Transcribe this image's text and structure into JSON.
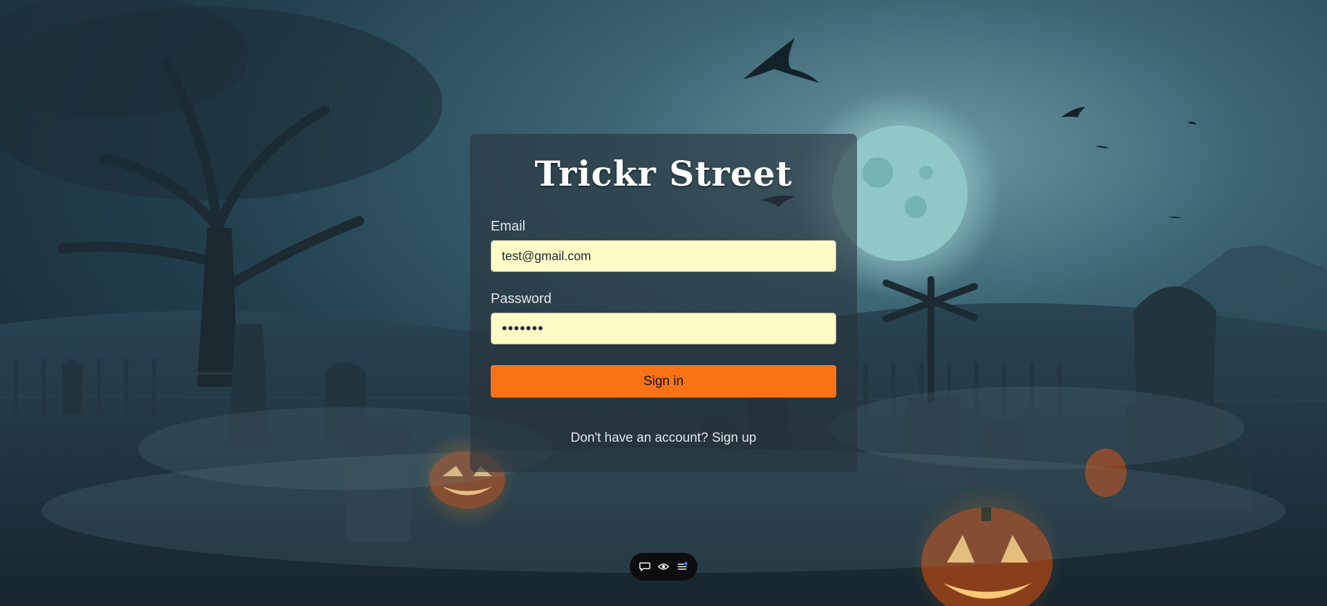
{
  "app": {
    "title": "Trickr Street"
  },
  "form": {
    "email_label": "Email",
    "email_value": "test@gmail.com",
    "password_label": "Password",
    "password_value": "•••••••",
    "signin_label": "Sign in",
    "signup_prompt": "Don't have an account?",
    "signup_link": "Sign up"
  },
  "dock": {
    "icons": [
      "chat-icon",
      "eye-icon",
      "menu-list-icon"
    ]
  },
  "colors": {
    "accent": "#f97316",
    "input_bg": "#fefbc7",
    "card_bg": "#28343e",
    "dock_bg": "#0d0d0f",
    "dock_badge": "#3b82f6"
  }
}
